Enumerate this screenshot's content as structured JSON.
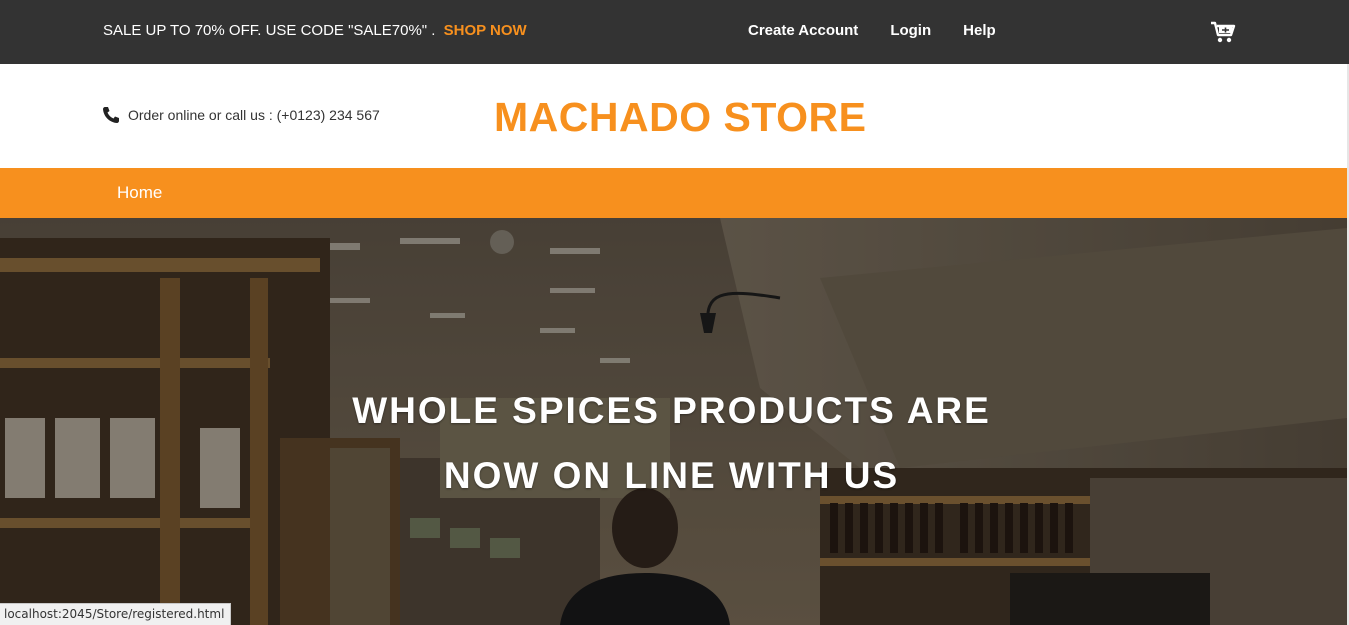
{
  "topbar": {
    "promo_text": "SALE UP TO 70% OFF. USE CODE \"SALE70%\" .",
    "shop_now": "SHOP NOW",
    "links": [
      "Create Account",
      "Login",
      "Help"
    ],
    "cart_icon": "cart-icon"
  },
  "header": {
    "contact_text": "Order online or call us : (+0123) 234 567",
    "phone_icon": "phone-icon",
    "brand": "MACHADO STORE"
  },
  "nav": {
    "items": [
      "Home"
    ]
  },
  "hero": {
    "line1": "WHOLE SPICES PRODUCTS ARE",
    "line2": "NOW ON LINE WITH US"
  },
  "status": {
    "url": "localhost:2045/Store/registered.html"
  },
  "colors": {
    "accent": "#f7901e",
    "topbar": "#333333"
  }
}
